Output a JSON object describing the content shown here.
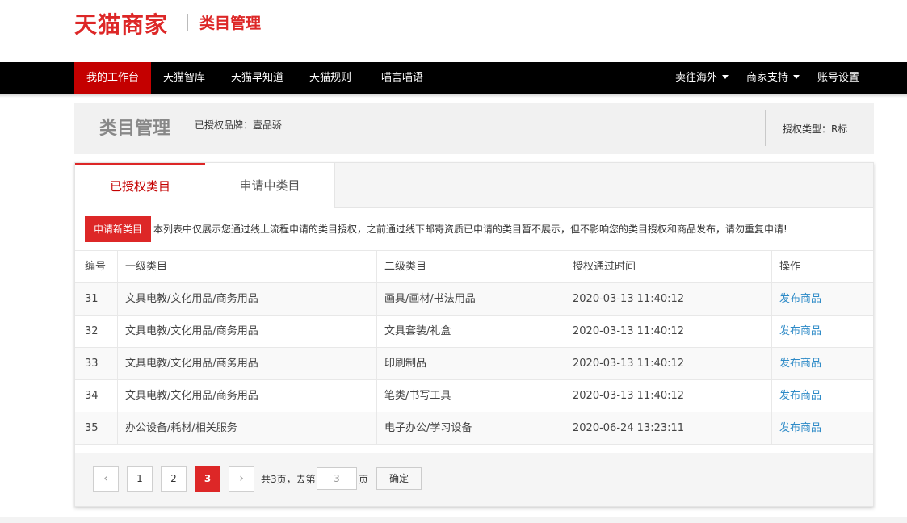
{
  "header": {
    "logo": "天猫商家",
    "section_title": "类目管理",
    "brand_color": "#dd2727"
  },
  "nav": {
    "items": [
      {
        "label": "我的工作台",
        "active": true
      },
      {
        "label": "天猫智库"
      },
      {
        "label": "天猫早知道"
      },
      {
        "label": "天猫规则"
      },
      {
        "label": "喵言喵语"
      }
    ],
    "right_items": [
      {
        "label": "卖往海外",
        "dropdown": true
      },
      {
        "label": "商家支持",
        "dropdown": true
      },
      {
        "label": "账号设置",
        "dropdown": false
      }
    ]
  },
  "info": {
    "title": "类目管理",
    "brand": "已授权品牌：壹品骄",
    "auth_type": "授权类型：R标"
  },
  "tabs": [
    {
      "label": "已授权类目",
      "active": true
    },
    {
      "label": "申请中类目",
      "active": false
    }
  ],
  "apply_button": "申请新类目",
  "notice": "本列表中仅展示您通过线上流程申请的类目授权，之前通过线下邮寄资质已申请的类目暂不展示，但不影响您的类目授权和商品发布，请勿重复申请!",
  "table": {
    "headers": [
      "编号",
      "一级类目",
      "二级类目",
      "授权通过时间",
      "操作"
    ],
    "rows": [
      {
        "id": "31",
        "cat1": "文具电教/文化用品/商务用品",
        "cat2": "画具/画材/书法用品",
        "time": "2020-03-13 11:40:12",
        "action": "发布商品"
      },
      {
        "id": "32",
        "cat1": "文具电教/文化用品/商务用品",
        "cat2": "文具套装/礼盒",
        "time": "2020-03-13 11:40:12",
        "action": "发布商品"
      },
      {
        "id": "33",
        "cat1": "文具电教/文化用品/商务用品",
        "cat2": "印刷制品",
        "time": "2020-03-13 11:40:12",
        "action": "发布商品"
      },
      {
        "id": "34",
        "cat1": "文具电教/文化用品/商务用品",
        "cat2": "笔类/书写工具",
        "time": "2020-03-13 11:40:12",
        "action": "发布商品"
      },
      {
        "id": "35",
        "cat1": "办公设备/耗材/相关服务",
        "cat2": "电子办公/学习设备",
        "time": "2020-06-24 13:23:11",
        "action": "发布商品"
      }
    ]
  },
  "pagination": {
    "prev_icon": "‹",
    "next_icon": "›",
    "pages": [
      "1",
      "2",
      "3"
    ],
    "current": "3",
    "total_text": "共3页，去第",
    "input_placeholder": "3",
    "page_suffix": "页",
    "confirm": "确定"
  }
}
